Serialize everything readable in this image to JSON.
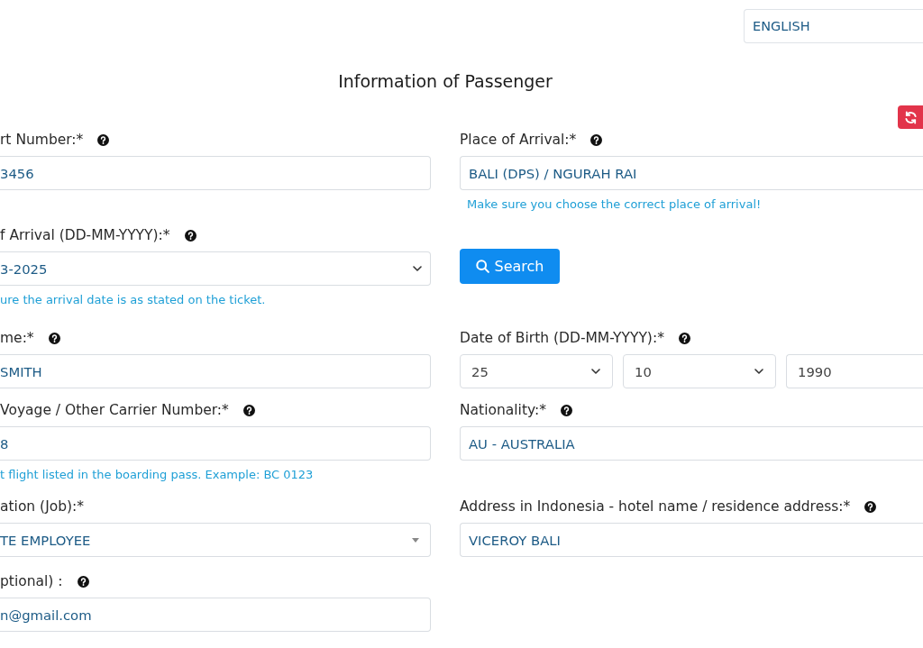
{
  "language_selector": {
    "value": "ENGLISH"
  },
  "title": "Information of Passenger",
  "left_column": [
    {
      "kind": "text",
      "label": "rt Number:*",
      "help": true,
      "value": "3456"
    },
    {
      "kind": "select",
      "label": "f Arrival (DD-MM-YYYY):*",
      "help": true,
      "value": "3-2025",
      "hint": "ure the arrival date is as stated on the ticket."
    },
    {
      "kind": "text",
      "label": "me:*",
      "help": true,
      "value": "SMITH"
    },
    {
      "kind": "text",
      "label": "Voyage / Other Carrier Number:*",
      "help": true,
      "value": "8",
      "hint": "t flight listed in the boarding pass. Example: BC 0123"
    },
    {
      "kind": "combo",
      "label": "ation (Job):*",
      "help": false,
      "value": "TE EMPLOYEE"
    },
    {
      "kind": "text",
      "label": "ptional) :",
      "help": true,
      "value": "n@gmail.com"
    }
  ],
  "right_column": [
    {
      "kind": "text",
      "label": "Place of Arrival:*",
      "help": true,
      "value": "BALI (DPS) / NGURAH RAI",
      "hint": "Make sure you choose the correct place of arrival!"
    },
    {
      "kind": "button",
      "text": "Search"
    },
    {
      "kind": "date_parts",
      "label": "Date of Birth (DD-MM-YYYY):*",
      "help": true,
      "parts": [
        {
          "kind": "select",
          "value": "25"
        },
        {
          "kind": "select",
          "value": "10"
        },
        {
          "kind": "text",
          "value": "1990"
        }
      ]
    },
    {
      "kind": "text",
      "label": "Nationality:*",
      "help": true,
      "value": "AU - AUSTRALIA"
    },
    {
      "kind": "text",
      "label": "Address in Indonesia - hotel name / residence address:*",
      "help": true,
      "value": "VICEROY BALI"
    }
  ]
}
